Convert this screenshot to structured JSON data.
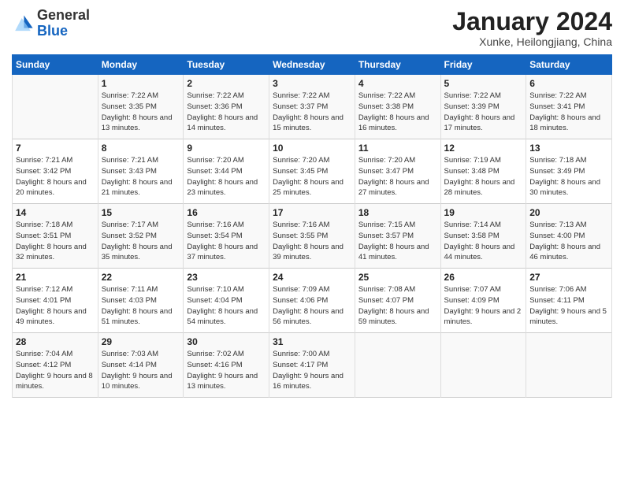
{
  "header": {
    "logo_line1": "General",
    "logo_line2": "Blue",
    "month": "January 2024",
    "location": "Xunke, Heilongjiang, China"
  },
  "days_of_week": [
    "Sunday",
    "Monday",
    "Tuesday",
    "Wednesday",
    "Thursday",
    "Friday",
    "Saturday"
  ],
  "weeks": [
    [
      {
        "day": "",
        "sunrise": "",
        "sunset": "",
        "daylight": ""
      },
      {
        "day": "1",
        "sunrise": "Sunrise: 7:22 AM",
        "sunset": "Sunset: 3:35 PM",
        "daylight": "Daylight: 8 hours and 13 minutes."
      },
      {
        "day": "2",
        "sunrise": "Sunrise: 7:22 AM",
        "sunset": "Sunset: 3:36 PM",
        "daylight": "Daylight: 8 hours and 14 minutes."
      },
      {
        "day": "3",
        "sunrise": "Sunrise: 7:22 AM",
        "sunset": "Sunset: 3:37 PM",
        "daylight": "Daylight: 8 hours and 15 minutes."
      },
      {
        "day": "4",
        "sunrise": "Sunrise: 7:22 AM",
        "sunset": "Sunset: 3:38 PM",
        "daylight": "Daylight: 8 hours and 16 minutes."
      },
      {
        "day": "5",
        "sunrise": "Sunrise: 7:22 AM",
        "sunset": "Sunset: 3:39 PM",
        "daylight": "Daylight: 8 hours and 17 minutes."
      },
      {
        "day": "6",
        "sunrise": "Sunrise: 7:22 AM",
        "sunset": "Sunset: 3:41 PM",
        "daylight": "Daylight: 8 hours and 18 minutes."
      }
    ],
    [
      {
        "day": "7",
        "sunrise": "Sunrise: 7:21 AM",
        "sunset": "Sunset: 3:42 PM",
        "daylight": "Daylight: 8 hours and 20 minutes."
      },
      {
        "day": "8",
        "sunrise": "Sunrise: 7:21 AM",
        "sunset": "Sunset: 3:43 PM",
        "daylight": "Daylight: 8 hours and 21 minutes."
      },
      {
        "day": "9",
        "sunrise": "Sunrise: 7:20 AM",
        "sunset": "Sunset: 3:44 PM",
        "daylight": "Daylight: 8 hours and 23 minutes."
      },
      {
        "day": "10",
        "sunrise": "Sunrise: 7:20 AM",
        "sunset": "Sunset: 3:45 PM",
        "daylight": "Daylight: 8 hours and 25 minutes."
      },
      {
        "day": "11",
        "sunrise": "Sunrise: 7:20 AM",
        "sunset": "Sunset: 3:47 PM",
        "daylight": "Daylight: 8 hours and 27 minutes."
      },
      {
        "day": "12",
        "sunrise": "Sunrise: 7:19 AM",
        "sunset": "Sunset: 3:48 PM",
        "daylight": "Daylight: 8 hours and 28 minutes."
      },
      {
        "day": "13",
        "sunrise": "Sunrise: 7:18 AM",
        "sunset": "Sunset: 3:49 PM",
        "daylight": "Daylight: 8 hours and 30 minutes."
      }
    ],
    [
      {
        "day": "14",
        "sunrise": "Sunrise: 7:18 AM",
        "sunset": "Sunset: 3:51 PM",
        "daylight": "Daylight: 8 hours and 32 minutes."
      },
      {
        "day": "15",
        "sunrise": "Sunrise: 7:17 AM",
        "sunset": "Sunset: 3:52 PM",
        "daylight": "Daylight: 8 hours and 35 minutes."
      },
      {
        "day": "16",
        "sunrise": "Sunrise: 7:16 AM",
        "sunset": "Sunset: 3:54 PM",
        "daylight": "Daylight: 8 hours and 37 minutes."
      },
      {
        "day": "17",
        "sunrise": "Sunrise: 7:16 AM",
        "sunset": "Sunset: 3:55 PM",
        "daylight": "Daylight: 8 hours and 39 minutes."
      },
      {
        "day": "18",
        "sunrise": "Sunrise: 7:15 AM",
        "sunset": "Sunset: 3:57 PM",
        "daylight": "Daylight: 8 hours and 41 minutes."
      },
      {
        "day": "19",
        "sunrise": "Sunrise: 7:14 AM",
        "sunset": "Sunset: 3:58 PM",
        "daylight": "Daylight: 8 hours and 44 minutes."
      },
      {
        "day": "20",
        "sunrise": "Sunrise: 7:13 AM",
        "sunset": "Sunset: 4:00 PM",
        "daylight": "Daylight: 8 hours and 46 minutes."
      }
    ],
    [
      {
        "day": "21",
        "sunrise": "Sunrise: 7:12 AM",
        "sunset": "Sunset: 4:01 PM",
        "daylight": "Daylight: 8 hours and 49 minutes."
      },
      {
        "day": "22",
        "sunrise": "Sunrise: 7:11 AM",
        "sunset": "Sunset: 4:03 PM",
        "daylight": "Daylight: 8 hours and 51 minutes."
      },
      {
        "day": "23",
        "sunrise": "Sunrise: 7:10 AM",
        "sunset": "Sunset: 4:04 PM",
        "daylight": "Daylight: 8 hours and 54 minutes."
      },
      {
        "day": "24",
        "sunrise": "Sunrise: 7:09 AM",
        "sunset": "Sunset: 4:06 PM",
        "daylight": "Daylight: 8 hours and 56 minutes."
      },
      {
        "day": "25",
        "sunrise": "Sunrise: 7:08 AM",
        "sunset": "Sunset: 4:07 PM",
        "daylight": "Daylight: 8 hours and 59 minutes."
      },
      {
        "day": "26",
        "sunrise": "Sunrise: 7:07 AM",
        "sunset": "Sunset: 4:09 PM",
        "daylight": "Daylight: 9 hours and 2 minutes."
      },
      {
        "day": "27",
        "sunrise": "Sunrise: 7:06 AM",
        "sunset": "Sunset: 4:11 PM",
        "daylight": "Daylight: 9 hours and 5 minutes."
      }
    ],
    [
      {
        "day": "28",
        "sunrise": "Sunrise: 7:04 AM",
        "sunset": "Sunset: 4:12 PM",
        "daylight": "Daylight: 9 hours and 8 minutes."
      },
      {
        "day": "29",
        "sunrise": "Sunrise: 7:03 AM",
        "sunset": "Sunset: 4:14 PM",
        "daylight": "Daylight: 9 hours and 10 minutes."
      },
      {
        "day": "30",
        "sunrise": "Sunrise: 7:02 AM",
        "sunset": "Sunset: 4:16 PM",
        "daylight": "Daylight: 9 hours and 13 minutes."
      },
      {
        "day": "31",
        "sunrise": "Sunrise: 7:00 AM",
        "sunset": "Sunset: 4:17 PM",
        "daylight": "Daylight: 9 hours and 16 minutes."
      },
      {
        "day": "",
        "sunrise": "",
        "sunset": "",
        "daylight": ""
      },
      {
        "day": "",
        "sunrise": "",
        "sunset": "",
        "daylight": ""
      },
      {
        "day": "",
        "sunrise": "",
        "sunset": "",
        "daylight": ""
      }
    ]
  ]
}
